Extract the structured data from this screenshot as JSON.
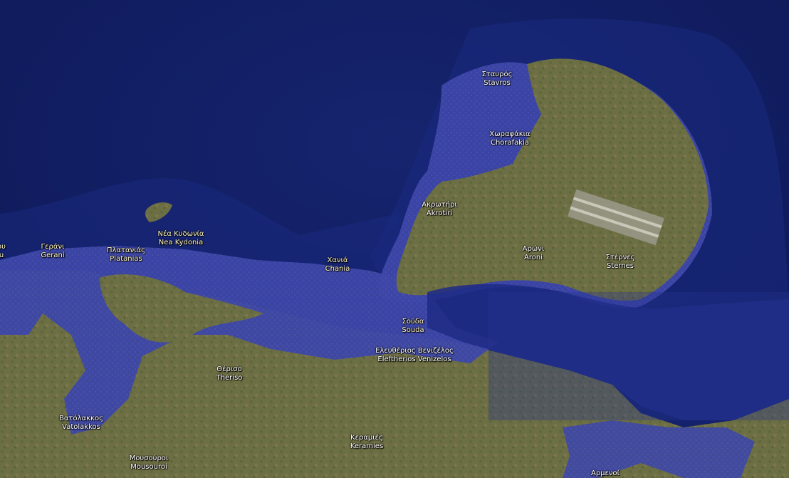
{
  "map": {
    "type": "satellite-imagery-with-flood-overlay",
    "colors": {
      "sea": "#13216b",
      "overlay": "#3c45a8",
      "land_light": "#7d7a4f",
      "land_dark": "#5a6238",
      "label": "#ffffff"
    },
    "places": [
      {
        "id": "stavros",
        "greek": "Σταυρός",
        "latin": "Stavros"
      },
      {
        "id": "chorafakia",
        "greek": "Χωραφάκια",
        "latin": "Chorafakia"
      },
      {
        "id": "akrotiri",
        "greek": "Ακρωτήρι",
        "latin": "Akrotiri"
      },
      {
        "id": "aroni",
        "greek": "Αρώνι",
        "latin": "Aroni"
      },
      {
        "id": "sternes",
        "greek": "Στέρνες",
        "latin": "Sternes"
      },
      {
        "id": "nea-kydonia",
        "greek": "Νέα Κυδωνία",
        "latin": "Nea Kydonia"
      },
      {
        "id": "platanias",
        "greek": "Πλατανιάς",
        "latin": "Platanias"
      },
      {
        "id": "gerani",
        "greek": "Γεράνι",
        "latin": "Gerani"
      },
      {
        "id": "chania",
        "greek": "Χανιά",
        "latin": "Chania"
      },
      {
        "id": "souda",
        "greek": "Σούδα",
        "latin": "Souda"
      },
      {
        "id": "eleftherios-venizelos",
        "greek": "Ελευθέριος Βενιζέλος",
        "latin": "Eleftherios Venizelos"
      },
      {
        "id": "theriso",
        "greek": "Θέρισο",
        "latin": "Theriso"
      },
      {
        "id": "vatolakkos",
        "greek": "Βατόλακκος",
        "latin": "Vatolakkos"
      },
      {
        "id": "keramies",
        "greek": "Κεραμιές",
        "latin": "Keramies"
      },
      {
        "id": "mousouroi",
        "greek": "Μουσούροι",
        "latin": "Mousouroi"
      },
      {
        "id": "armenoi",
        "greek": "Αρμενοί",
        "latin": ""
      },
      {
        "id": "edge-left",
        "greek": "ου",
        "latin": "u"
      }
    ]
  }
}
